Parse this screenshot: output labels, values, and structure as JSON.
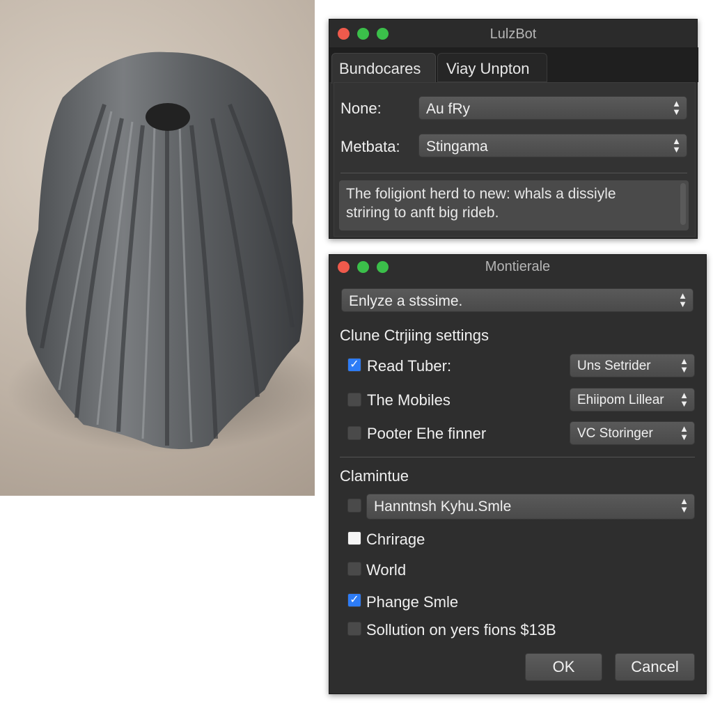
{
  "colors": {
    "close": "#ef5a4c",
    "minimize": "#3bbf4a",
    "zoom": "#3bbf4a",
    "accent": "#2d7cf6",
    "window_bg": "#2e2e2e"
  },
  "window1": {
    "title": "LulzBot",
    "tabs": [
      {
        "label": "Bundocares",
        "active": true
      },
      {
        "label": "Viay Unpton",
        "active": false
      }
    ],
    "fields": [
      {
        "label": "None:",
        "value": "Au fRy"
      },
      {
        "label": "Metbata:",
        "value": "Stingama"
      }
    ],
    "textarea": {
      "line1": "The foligiont herd to new: whals a dissiyle",
      "line2": "striring to anft big rideb."
    }
  },
  "window2": {
    "title": "Montierale",
    "top_select": "Enlyze a stssime.",
    "section1": "Clune Ctrjiing settings",
    "rows": [
      {
        "label": "Read Tuber:",
        "checked": true,
        "select": "Uns Setrider"
      },
      {
        "label": "The Mobiles",
        "checked": false,
        "select": "Ehiipom Lillear"
      },
      {
        "label": "Pooter Ehe finner",
        "checked": false,
        "select": "VC Storinger"
      }
    ],
    "section2": "Clamintue",
    "select_row": {
      "value": "Hanntnsh Kyhu.Smle",
      "checked": false
    },
    "checks": [
      {
        "label": "Chrirage",
        "checked": false
      },
      {
        "label": "World",
        "checked": false
      },
      {
        "label": "Phange Smle",
        "checked": true
      },
      {
        "label": "Sollution on yers fions $13B",
        "checked": false
      }
    ],
    "ok": "OK",
    "cancel": "Cancel"
  }
}
